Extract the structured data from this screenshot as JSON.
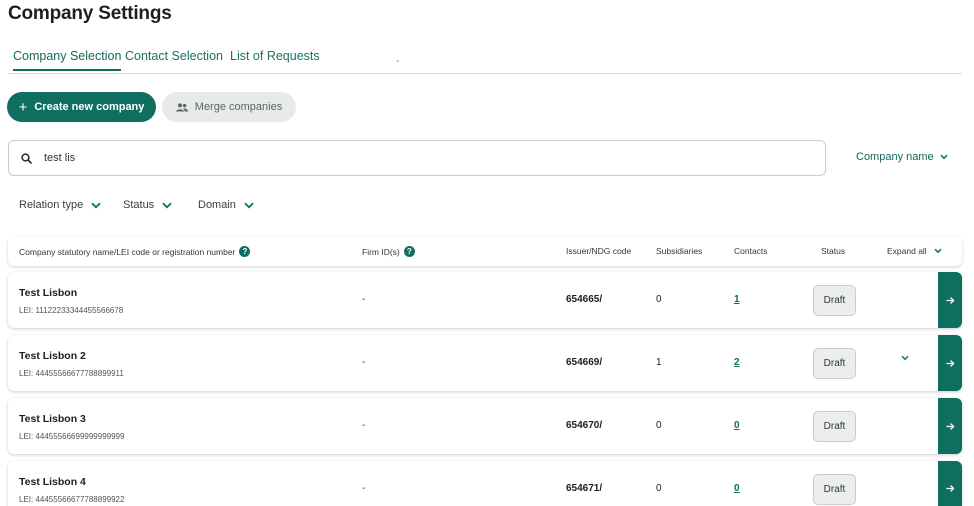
{
  "page": {
    "title": "Company Settings"
  },
  "tabs": [
    {
      "label": "Company Selection",
      "active": true
    },
    {
      "label": "Contact Selection",
      "active": false
    },
    {
      "label": "List of Requests",
      "active": false
    }
  ],
  "tab_dash": "-",
  "actions": {
    "create_label": "Create new company",
    "merge_label": "Merge companies"
  },
  "search": {
    "value": "test lis"
  },
  "sort": {
    "label": "Company name"
  },
  "filters": {
    "relation": "Relation type",
    "status": "Status",
    "domain": "Domain"
  },
  "table": {
    "headers": {
      "name": "Company statutory name/LEI code or registration number",
      "firm": "Firm ID(s)",
      "issuer": "Issuer/NDG code",
      "subsidiaries": "Subsidiaries",
      "contacts": "Contacts",
      "status": "Status",
      "expand_all": "Expand all"
    },
    "rows": [
      {
        "name": "Test Lisbon",
        "lei": "LEI: 11122233344455566678",
        "firm": "-",
        "issuer": "654665/",
        "subsidiaries": "0",
        "contacts": "1",
        "status": "Draft",
        "expandable": false
      },
      {
        "name": "Test Lisbon 2",
        "lei": "LEI: 44455566677788899911",
        "firm": "-",
        "issuer": "654669/",
        "subsidiaries": "1",
        "contacts": "2",
        "status": "Draft",
        "expandable": true
      },
      {
        "name": "Test Lisbon 3",
        "lei": "LEI: 44455566699999999999",
        "firm": "-",
        "issuer": "654670/",
        "subsidiaries": "0",
        "contacts": "0",
        "status": "Draft",
        "expandable": false
      },
      {
        "name": "Test Lisbon 4",
        "lei": "LEI: 44455566677788899922",
        "firm": "-",
        "issuer": "654671/",
        "subsidiaries": "0",
        "contacts": "0",
        "status": "Draft",
        "expandable": false
      }
    ]
  },
  "icons": {
    "search": "search-icon",
    "merge": "group-icon",
    "chevron": "chevron-down-icon",
    "arrow": "arrow-right-icon",
    "help": "question-icon"
  },
  "help_glyph": "?",
  "colors": {
    "accent": "#0e6e60",
    "secondary_bg": "#e8eaea",
    "status_bg": "#eceeee"
  }
}
